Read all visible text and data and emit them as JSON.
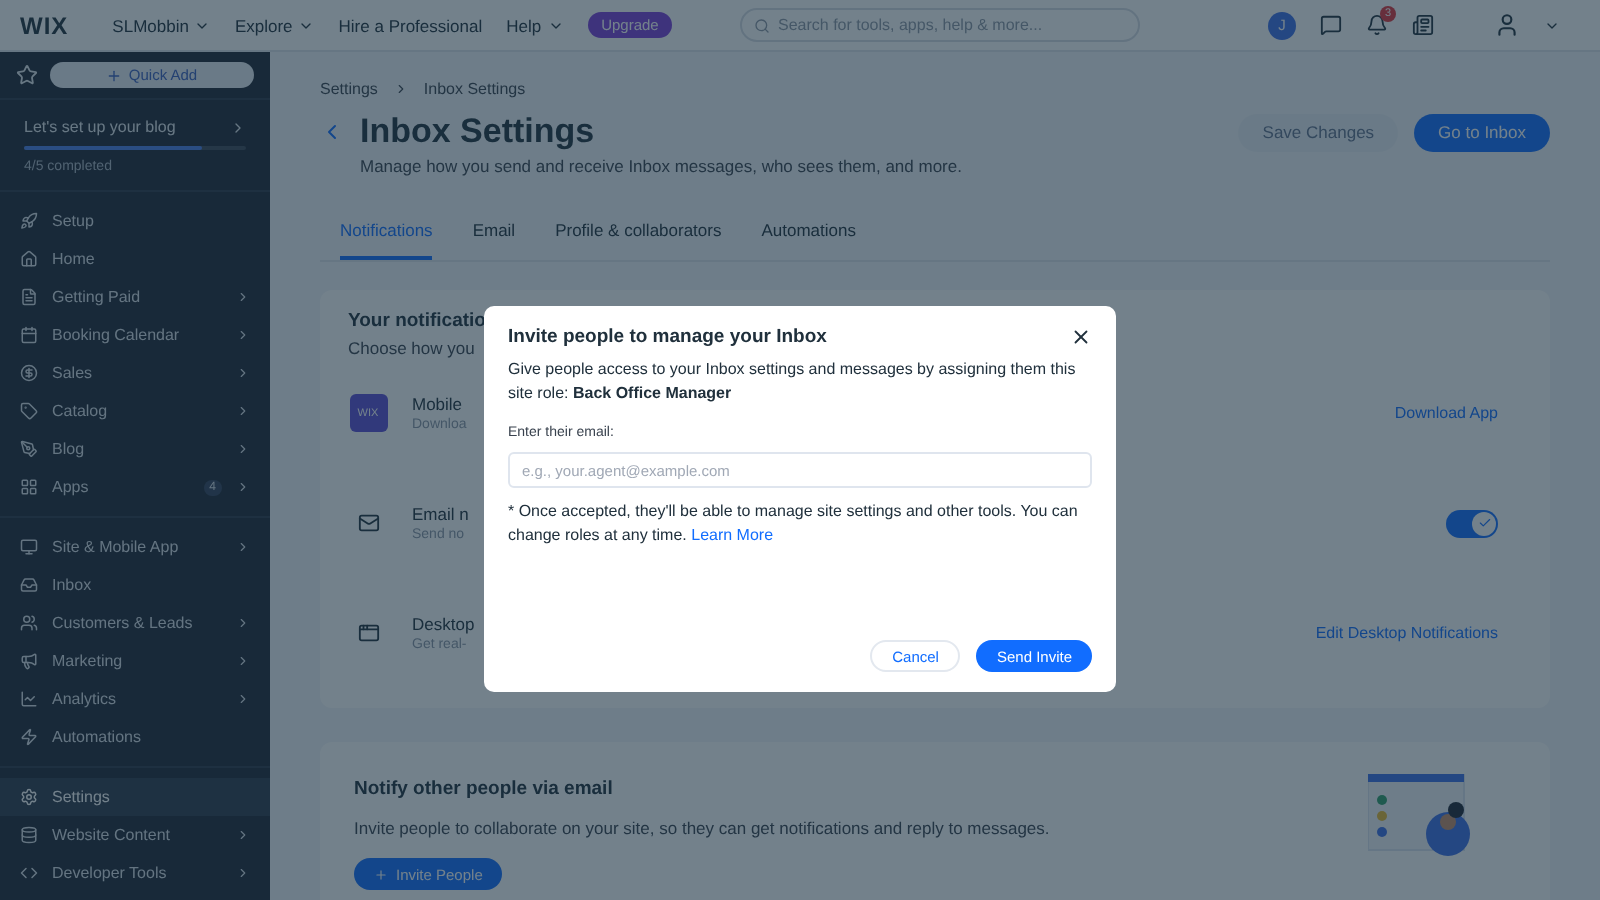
{
  "topbar": {
    "logo": "WIX",
    "site": "SLMobbin",
    "nav": [
      {
        "label": "Explore",
        "dropdown": true
      },
      {
        "label": "Hire a Professional",
        "dropdown": false
      },
      {
        "label": "Help",
        "dropdown": true
      }
    ],
    "upgrade": "Upgrade",
    "search": {
      "placeholder": "Search for tools, apps, help & more..."
    },
    "avatar_initial": "J",
    "notification_count": "3"
  },
  "sidebar": {
    "quick_add": "Quick Add",
    "setup": {
      "title": "Let's set up your blog",
      "level": 0.8,
      "progress": "4/5 completed"
    },
    "sections": [
      [
        {
          "label": "Setup",
          "arrow": false,
          "selected": false
        },
        {
          "label": "Home",
          "arrow": false,
          "selected": false
        },
        {
          "label": "Getting Paid",
          "arrow": true,
          "selected": false
        },
        {
          "label": "Booking Calendar",
          "arrow": true,
          "selected": false
        },
        {
          "label": "Sales",
          "arrow": true,
          "selected": false
        },
        {
          "label": "Catalog",
          "arrow": true,
          "selected": false
        },
        {
          "label": "Blog",
          "arrow": true,
          "selected": false
        },
        {
          "label": "Apps",
          "arrow": true,
          "selected": false,
          "badge": "4"
        }
      ],
      [
        {
          "label": "Site & Mobile App",
          "arrow": true,
          "selected": false
        },
        {
          "label": "Inbox",
          "arrow": false,
          "selected": false
        },
        {
          "label": "Customers & Leads",
          "arrow": true,
          "selected": false
        },
        {
          "label": "Marketing",
          "arrow": true,
          "selected": false
        },
        {
          "label": "Analytics",
          "arrow": true,
          "selected": false
        },
        {
          "label": "Automations",
          "arrow": false,
          "selected": false
        }
      ],
      [
        {
          "label": "Settings",
          "arrow": false,
          "selected": true
        },
        {
          "label": "Website Content",
          "arrow": true,
          "selected": false
        },
        {
          "label": "Developer Tools",
          "arrow": true,
          "selected": false
        }
      ]
    ]
  },
  "breadcrumbs": [
    "Settings",
    "Inbox Settings"
  ],
  "page": {
    "title": "Inbox Settings",
    "subtitle": "Manage how you send and receive Inbox messages, who sees them, and more.",
    "buttons": [
      {
        "label": "Save Changes",
        "kind": "secondary",
        "disabled": true
      },
      {
        "label": "Go to Inbox",
        "kind": "primary",
        "disabled": false
      }
    ]
  },
  "tabs": [
    {
      "label": "Notifications",
      "selected": true
    },
    {
      "label": "Email",
      "selected": false
    },
    {
      "label": "Profile & collaborators",
      "selected": false
    },
    {
      "label": "Automations",
      "selected": false
    }
  ],
  "notifications_card": {
    "title": "Your notificatio",
    "subtitle": "Choose how you",
    "rows": [
      {
        "kind": "app",
        "title": "Mobile",
        "subtitle": "Downloa",
        "action": "Download App",
        "logo": "WIX"
      },
      {
        "kind": "toggle",
        "title": "Email n",
        "subtitle": "Send no",
        "on": true
      },
      {
        "kind": "link",
        "title": "Desktop",
        "subtitle": "Get real-",
        "action": "Edit Desktop Notifications"
      }
    ]
  },
  "invite_card": {
    "title": "Notify other people via email",
    "text": "Invite people to collaborate on your site, so they can get notifications and reply to messages.",
    "button": "Invite People"
  },
  "dialog": {
    "title": "Invite people to manage your Inbox",
    "text": "Give people access to your Inbox settings and messages by assigning them this site role: **Back Office Manager**",
    "email_label": "Enter their email:",
    "email": {
      "placeholder": "e.g., your.agent@example.com"
    },
    "note": "* Once accepted, they'll be able to manage site settings and other tools. You can change roles at any time.",
    "learn_more": "Learn More",
    "cancel": "Cancel",
    "send": "Send Invite"
  }
}
